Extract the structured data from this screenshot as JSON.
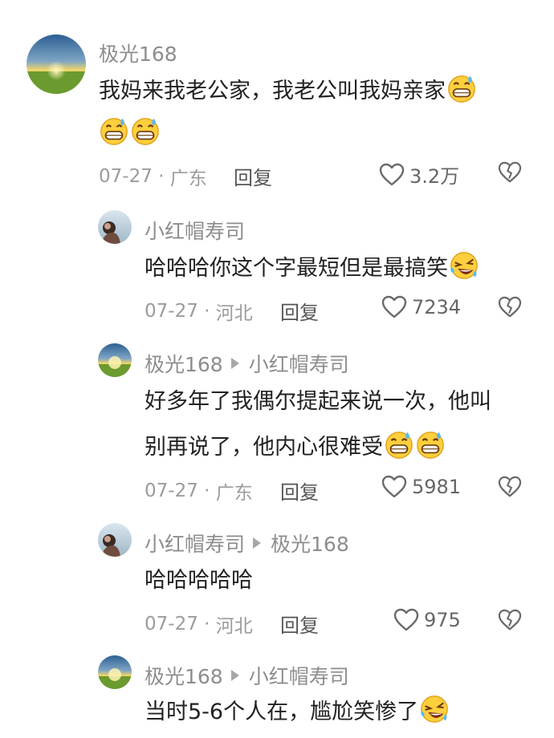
{
  "comments": [
    {
      "author": "极光168",
      "text_lines": [
        "我妈来我老公家，我老公叫我妈亲家",
        ""
      ],
      "date": "07-27",
      "sep": "·",
      "region": "广东",
      "reply_label": "回复",
      "likes": "3.2万",
      "avatar": "sunrise"
    },
    {
      "author": "小红帽寿司",
      "text_lines": [
        "哈哈哈你这个字最短但是最搞笑"
      ],
      "date": "07-27",
      "sep": "·",
      "region": "河北",
      "reply_label": "回复",
      "likes": "7234",
      "avatar": "person"
    },
    {
      "author": "极光168",
      "reply_to": "小红帽寿司",
      "text_lines": [
        "好多年了我偶尔提起来说一次，他叫",
        "别再说了，他内心很难受"
      ],
      "date": "07-27",
      "sep": "·",
      "region": "广东",
      "reply_label": "回复",
      "likes": "5981",
      "avatar": "sunrise"
    },
    {
      "author": "小红帽寿司",
      "reply_to": "极光168",
      "text_lines": [
        "哈哈哈哈哈"
      ],
      "date": "07-27",
      "sep": "·",
      "region": "河北",
      "reply_label": "回复",
      "likes": "975",
      "avatar": "person"
    },
    {
      "author": "极光168",
      "reply_to": "小红帽寿司",
      "text_lines": [
        "当时5-6个人在，尴尬笑惨了"
      ],
      "avatar": "sunrise"
    }
  ],
  "icons": {
    "like": "heart-outline-icon",
    "dislike": "broken-heart-icon",
    "emoji_sweat": "grinning-sweat-emoji",
    "emoji_laugh": "rolling-laughing-emoji"
  },
  "colors": {
    "name": "#8d8d8d",
    "meta": "#9b9b9b",
    "text": "#222222"
  }
}
